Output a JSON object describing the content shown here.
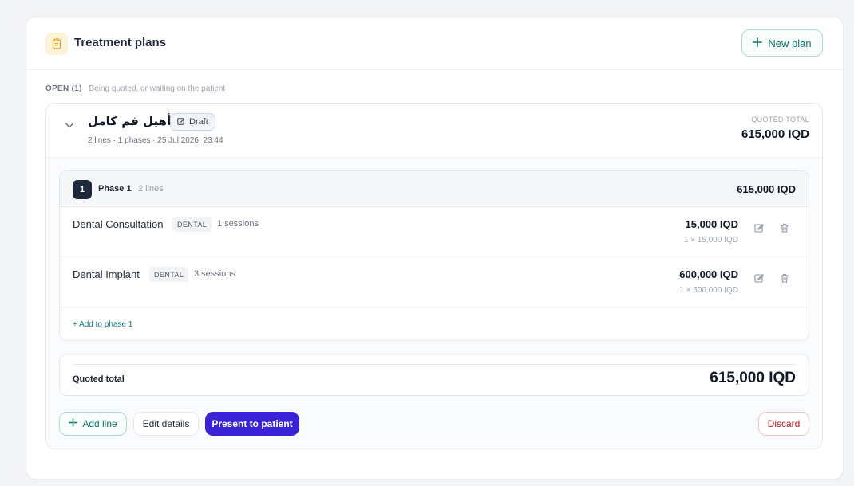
{
  "header": {
    "title": "Treatment plans",
    "icon": "clipboard-icon",
    "new_plan_label": "New plan"
  },
  "section": {
    "label": "OPEN (1)",
    "description": "Being quoted, or waiting on the patient"
  },
  "plan": {
    "name": "تأهيل فم كامل",
    "status": "Draft",
    "meta": "2 lines · 1 phases · 25 Jul 2026, 23:44",
    "quoted_total_label": "QUOTED TOTAL",
    "quoted_total": "615,000 IQD",
    "phases": [
      {
        "number": "1",
        "name": "Phase 1",
        "lines_count": "2 lines",
        "total": "615,000 IQD",
        "add_label": "+ Add to phase 1",
        "lines": [
          {
            "name": "Dental Consultation",
            "category": "DENTAL",
            "sessions": "1 sessions",
            "price": "15,000 IQD",
            "calc": "1 × 15,000 IQD"
          },
          {
            "name": "Dental Implant",
            "category": "DENTAL",
            "sessions": "3 sessions",
            "price": "600,000 IQD",
            "calc": "1 × 600,000 IQD"
          }
        ]
      }
    ],
    "summary": {
      "label": "Quoted total",
      "value": "615,000 IQD"
    },
    "actions": {
      "add_line": "Add line",
      "edit_details": "Edit details",
      "present": "Present to patient",
      "discard": "Discard"
    }
  },
  "colors": {
    "accent_teal": "#0f766e",
    "primary_purple": "#3a22d6",
    "danger_red": "#b91c1c",
    "phase_badge": "#1e293b"
  }
}
